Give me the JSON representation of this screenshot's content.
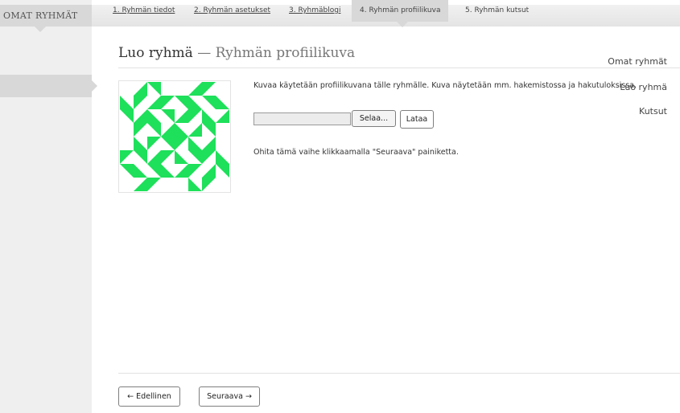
{
  "sidebar": {
    "header": "OMAT RYHMÄT",
    "items": [
      {
        "label": "Omat ryhmät"
      },
      {
        "label": "Luo ryhmä"
      },
      {
        "label": "Kutsut"
      }
    ]
  },
  "steps": [
    {
      "label": "1. Ryhmän tiedot"
    },
    {
      "label": "2. Ryhmän asetukset"
    },
    {
      "label": "3. Ryhmäblogi"
    },
    {
      "label": "4. Ryhmän profiilikuva"
    },
    {
      "label": "5. Ryhmän kutsut"
    }
  ],
  "page": {
    "title": "Luo ryhmä",
    "separator": " — ",
    "subtitle": "Ryhmän profiilikuva"
  },
  "upload": {
    "description": "Kuvaa käytetään profiilikuvana tälle ryhmälle. Kuva näytetään mm. hakemistossa ja hakutuloksissa.",
    "browse_label": "Selaa...",
    "upload_label": "Lataa",
    "skip_text": "Ohita tämä vaihe klikkaamalla \"Seuraava\" painiketta."
  },
  "nav": {
    "prev_label": "← Edellinen",
    "next_label": "Seuraava →"
  },
  "colors": {
    "avatar_green": "#1ee05a"
  },
  "icons": {
    "avatar": "identicon-image"
  }
}
